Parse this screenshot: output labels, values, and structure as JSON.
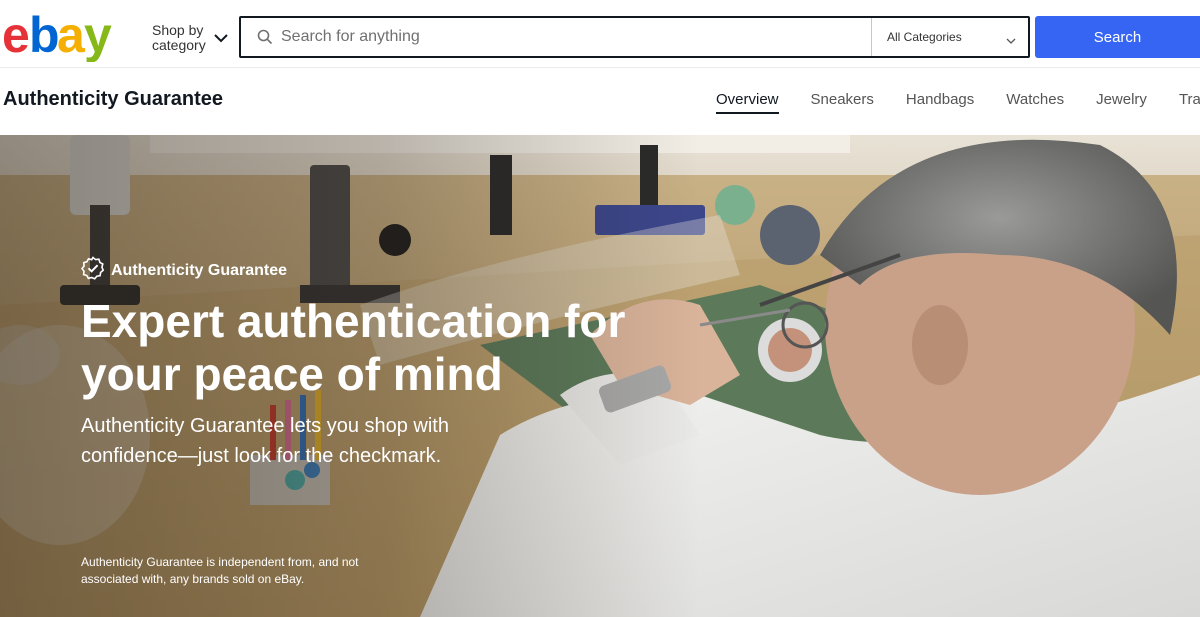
{
  "header": {
    "logo_text": "ebay",
    "logo_colors": [
      "#e53238",
      "#0064d2",
      "#f5af02",
      "#86b817"
    ],
    "shop_by_category": "Shop by category",
    "search": {
      "placeholder": "Search for anything",
      "value": "",
      "category": "All Categories",
      "button_label": "Search"
    },
    "accent_color": "#3665f3"
  },
  "subnav": {
    "title": "Authenticity Guarantee",
    "tabs": [
      {
        "label": "Overview",
        "active": true
      },
      {
        "label": "Sneakers",
        "active": false
      },
      {
        "label": "Handbags",
        "active": false
      },
      {
        "label": "Watches",
        "active": false
      },
      {
        "label": "Jewelry",
        "active": false
      },
      {
        "label": "Tra",
        "active": false
      }
    ]
  },
  "hero": {
    "badge_icon": "check-circle-icon",
    "badge_label": "Authenticity Guarantee",
    "headline": "Expert authentication for your peace of mind",
    "subline": "Authenticity Guarantee lets you shop with confidence—just look for the checkmark.",
    "disclaimer": "Authenticity Guarantee is independent from, and not associated with, any brands sold on eBay."
  }
}
